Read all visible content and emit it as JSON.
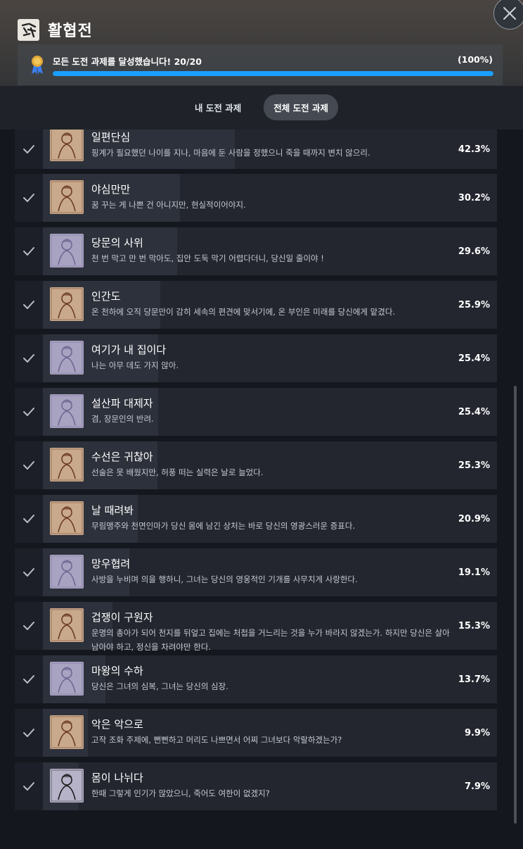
{
  "header": {
    "title": "활협전",
    "logo_icon": "game-logo-icon",
    "close_icon": "close-icon"
  },
  "progress": {
    "text": "모든 도전 과제를 달성했습니다! 20/20",
    "percent_text": "(100%)",
    "fraction": 1.0,
    "icon": "ribbon-award-icon",
    "bar_color": "#1a9fff"
  },
  "tabs": [
    {
      "label": "내 도전 과제",
      "active": false
    },
    {
      "label": "전체 도전 과제",
      "active": true
    }
  ],
  "achievements": [
    {
      "title": "일편단심",
      "desc": "핑계가 필요했던 나이를 지나, 마음에 둔 사람을 정했으니 죽을 때까지 변치 않으리.",
      "pct": "42.3%",
      "value": 42.3,
      "thumb": "sepia"
    },
    {
      "title": "야심만만",
      "desc": "꿈 꾸는 게 나쁜 건 아니지만, 현실적이어야지.",
      "pct": "30.2%",
      "value": 30.2,
      "thumb": "sepia"
    },
    {
      "title": "당문의 사위",
      "desc": "천 번 막고 만 번 막아도, 집안 도둑 막기 어렵다더니, 당신일 줄이야 !",
      "pct": "29.6%",
      "value": 29.6,
      "thumb": "lavender"
    },
    {
      "title": "인간도",
      "desc": "온 천하에 오직 당문만이 감히 세속의 편견에 맞서기에, 온 부인은 미래를 당신에게 맡겼다.",
      "pct": "25.9%",
      "value": 25.9,
      "thumb": "sepia"
    },
    {
      "title": "여기가 내 집이다",
      "desc": "나는 아무 데도 가지 않아.",
      "pct": "25.4%",
      "value": 25.4,
      "thumb": "lavender"
    },
    {
      "title": "설산파 대제자",
      "desc": "겸, 장문인의 반려.",
      "pct": "25.4%",
      "value": 25.4,
      "thumb": "lavender"
    },
    {
      "title": "수선은 귀찮아",
      "desc": "선술은 못 배웠지만, 허풍 떠는 실력은 날로 늘었다.",
      "pct": "25.3%",
      "value": 25.3,
      "thumb": "sepia"
    },
    {
      "title": "날 때려봐",
      "desc": "무림맹주와 천면인마가 당신 몸에 남긴 상처는 바로 당신의 영광스러운 증표다.",
      "pct": "20.9%",
      "value": 20.9,
      "thumb": "sepia"
    },
    {
      "title": "망우협려",
      "desc": "사방을 누비며 의을 행하니, 그녀는 당신의 영웅적인 기개를 사무치게 사랑한다.",
      "pct": "19.1%",
      "value": 19.1,
      "thumb": "lavender"
    },
    {
      "title": "겁쟁이 구원자",
      "desc": "운명의 총아가 되어 천지를 뒤엎고 집에는 처첩을 거느리는 것을 누가 바라지 않겠는가. 하지만 당신은 살아남아야 하고, 정신을 차려야만 한다.",
      "pct": "15.3%",
      "value": 15.3,
      "thumb": "sepia"
    },
    {
      "title": "마왕의 수하",
      "desc": "당신은 그녀의 심복, 그녀는 당신의 심장.",
      "pct": "13.7%",
      "value": 13.7,
      "thumb": "lavender"
    },
    {
      "title": "악은 악으로",
      "desc": "고작 조화 주제에, 뻔뻔하고 머리도 나쁘면서 어찌 그녀보다 악랄하겠는가?",
      "pct": "9.9%",
      "value": 9.9,
      "thumb": "sepia"
    },
    {
      "title": "몸이 나뉘다",
      "desc": "한때 그렇게 인기가 많았으니, 죽어도 여한이 없겠지?",
      "pct": "7.9%",
      "value": 7.9,
      "thumb": "ink"
    }
  ]
}
